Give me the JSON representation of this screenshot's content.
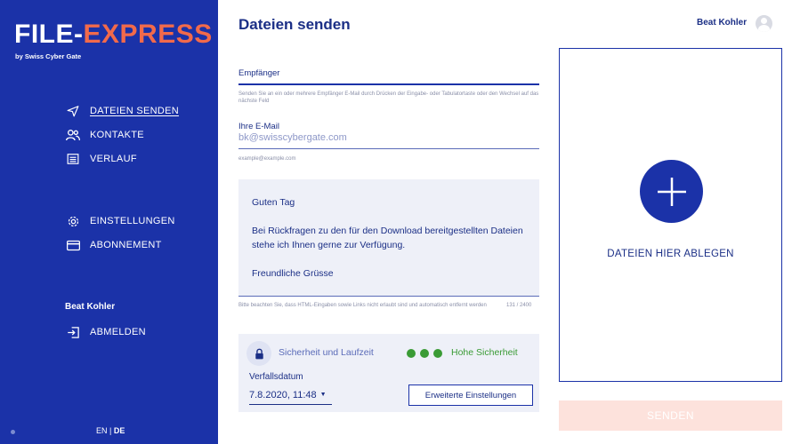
{
  "brand": {
    "logo_part1": "FILE-",
    "logo_part2": "EXPRESS",
    "subtitle": "by Swiss Cyber Gate",
    "accent_color": "#f26a4b",
    "sidebar_color": "#1b32a8"
  },
  "sidebar": {
    "items": [
      {
        "label": "DATEIEN SENDEN",
        "icon": "send-icon",
        "active": true
      },
      {
        "label": "KONTAKTE",
        "icon": "contacts-icon"
      },
      {
        "label": "VERLAUF",
        "icon": "history-icon"
      },
      {
        "label": "EINSTELLUNGEN",
        "icon": "gear-icon"
      },
      {
        "label": "ABONNEMENT",
        "icon": "credit-card-icon"
      }
    ],
    "user_name": "Beat Kohler",
    "logout_label": "ABMELDEN",
    "lang_en": "EN",
    "lang_sep": "|",
    "lang_de": "DE"
  },
  "header": {
    "title": "Dateien senden",
    "user_name": "Beat Kohler"
  },
  "form": {
    "recipient_label": "Empfänger",
    "recipient_hint": "Senden Sie an ein oder mehrere Empfänger E-Mail durch Drücken der Eingabe- oder Tabulatortaste oder den Wechsel auf das nächste Feld",
    "email_label": "Ihre E-Mail",
    "email_value": "bk@swisscybergate.com",
    "email_hint": "example@example.com",
    "message_lines": [
      "Guten Tag",
      "Bei Rückfragen zu den für den Download bereitgestellten Dateien stehe ich Ihnen gerne zur Verfügung.",
      "Freundliche Grüsse"
    ],
    "message_hint": "Bitte beachten Sie, dass HTML-Eingaben sowie Links nicht erlaubt sind und automatisch entfernt werden",
    "char_count": "131 / 2400"
  },
  "security": {
    "title": "Sicherheit und Laufzeit",
    "level": "Hohe Sicherheit",
    "level_color": "#3a9b35",
    "expiry_label": "Verfallsdatum",
    "expiry_value": "7.8.2020, 11:48",
    "advanced_button": "Erweiterte Einstellungen"
  },
  "dropzone": {
    "label": "DATEIEN HIER ABLEGEN"
  },
  "send_button": "SENDEN"
}
